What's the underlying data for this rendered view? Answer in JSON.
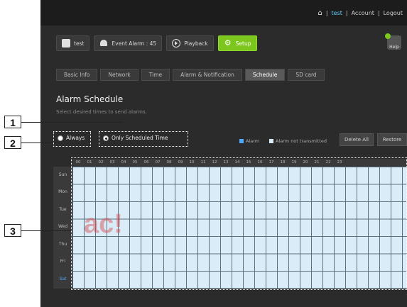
{
  "topbar": {
    "user": "test",
    "account": "Account",
    "logout": "Logout",
    "sep": "|"
  },
  "mainnav": [
    {
      "label": "test",
      "icon": "camera-icon"
    },
    {
      "label": "Event Alarm : 45",
      "icon": "alarm-bell-icon"
    },
    {
      "label": "Playback",
      "icon": "play-icon"
    },
    {
      "label": "Setup",
      "icon": "gear-icon",
      "active": true
    }
  ],
  "help_label": "Help",
  "subtabs": [
    {
      "label": "Basic Info"
    },
    {
      "label": "Network"
    },
    {
      "label": "Time"
    },
    {
      "label": "Alarm & Notification"
    },
    {
      "label": "Schedule",
      "active": true
    },
    {
      "label": "SD card"
    }
  ],
  "page": {
    "title": "Alarm Schedule",
    "subtitle": "Select desired times to send alarms."
  },
  "radios": {
    "always": "Always",
    "scheduled": "Only Scheduled Time"
  },
  "legend": {
    "alarm": "Alarm",
    "not_transmitted": "Alarm not transmitted"
  },
  "buttons": {
    "delete_all": "Delete All",
    "restore": "Restore"
  },
  "hours": [
    "00",
    "01",
    "02",
    "03",
    "04",
    "05",
    "06",
    "07",
    "08",
    "09",
    "10",
    "11",
    "12",
    "13",
    "14",
    "15",
    "16",
    "17",
    "18",
    "19",
    "20",
    "21",
    "22",
    "23"
  ],
  "days": [
    "Sun",
    "Mon",
    "Tue",
    "Wed",
    "Thu",
    "Fri",
    "Sat"
  ],
  "callouts": [
    "1",
    "2",
    "3"
  ],
  "watermark": {
    "text": "ac!"
  },
  "colors": {
    "accent": "#7cc61d",
    "grid": "#d9ecf7",
    "topbar": "#1c1c1c",
    "callout_border": "#222222",
    "link": "#5fd0ff",
    "legend_alarm": "#4aa8ff",
    "legend_not": "#d9ecf7"
  }
}
